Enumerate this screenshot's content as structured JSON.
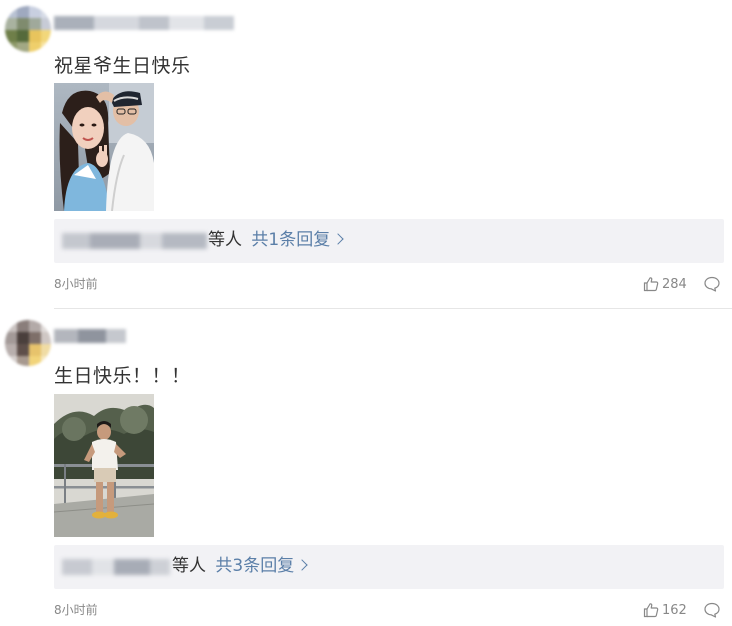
{
  "comments": [
    {
      "text": "祝星爷生日快乐",
      "reply_suffix": "等人",
      "reply_link": "共1条回复",
      "time": "8小时前",
      "likes": "284"
    },
    {
      "text": "生日快乐！！！",
      "reply_suffix": "等人",
      "reply_link": "共3条回复",
      "time": "8小时前",
      "likes": "162"
    }
  ],
  "icons": {
    "like": "thumbs-up-icon",
    "comment": "comment-bubble-icon",
    "reply_arrow": "chevron-right-icon"
  },
  "colors": {
    "link": "#5b7fa8",
    "reply_bg": "#f2f2f5",
    "meta_text": "#888888",
    "body_text": "#333333"
  }
}
